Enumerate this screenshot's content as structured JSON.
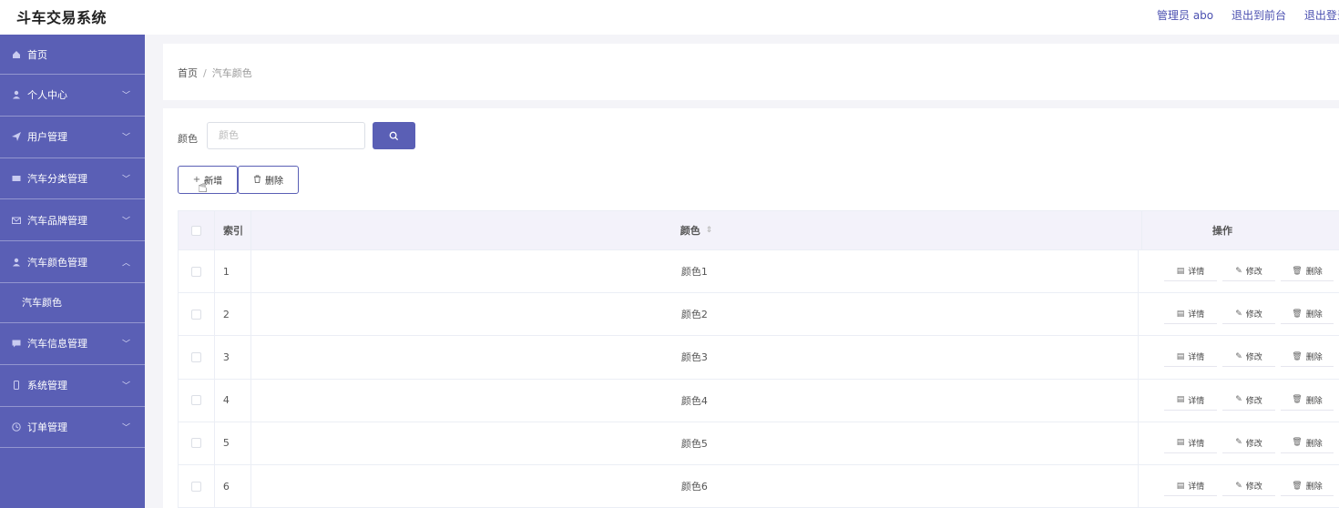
{
  "app": {
    "title": "斗车交易系统"
  },
  "topbar": {
    "admin_label": "管理员 abo",
    "front_link": "退出到前台",
    "logout_link": "退出登录"
  },
  "sidebar": {
    "items": [
      {
        "label": "首页",
        "icon": "home-icon"
      },
      {
        "label": "个人中心",
        "icon": "user-icon"
      },
      {
        "label": "用户管理",
        "icon": "send-icon"
      },
      {
        "label": "汽车分类管理",
        "icon": "ticket-icon"
      },
      {
        "label": "汽车品牌管理",
        "icon": "mail-icon"
      },
      {
        "label": "汽车颜色管理",
        "icon": "user-icon"
      },
      {
        "label": "汽车颜色",
        "sub": true
      },
      {
        "label": "汽车信息管理",
        "icon": "message-icon"
      },
      {
        "label": "系统管理",
        "icon": "phone-icon"
      },
      {
        "label": "订单管理",
        "icon": "clock-icon"
      }
    ]
  },
  "breadcrumb": {
    "home": "首页",
    "current": "汽车颜色"
  },
  "search": {
    "label": "颜色",
    "placeholder": "颜色"
  },
  "actions": {
    "add": "新增",
    "delete": "删除"
  },
  "table": {
    "headers": {
      "index": "索引",
      "color": "颜色",
      "ops": "操作"
    },
    "rows": [
      {
        "index": "1",
        "color": "颜色1"
      },
      {
        "index": "2",
        "color": "颜色2"
      },
      {
        "index": "3",
        "color": "颜色3"
      },
      {
        "index": "4",
        "color": "颜色4"
      },
      {
        "index": "5",
        "color": "颜色5"
      },
      {
        "index": "6",
        "color": "颜色6"
      }
    ],
    "row_actions": {
      "detail": "详情",
      "edit": "修改",
      "delete": "删除"
    }
  },
  "colors": {
    "accent": "#5a5fb5",
    "header_bg": "#f3f2fa"
  }
}
